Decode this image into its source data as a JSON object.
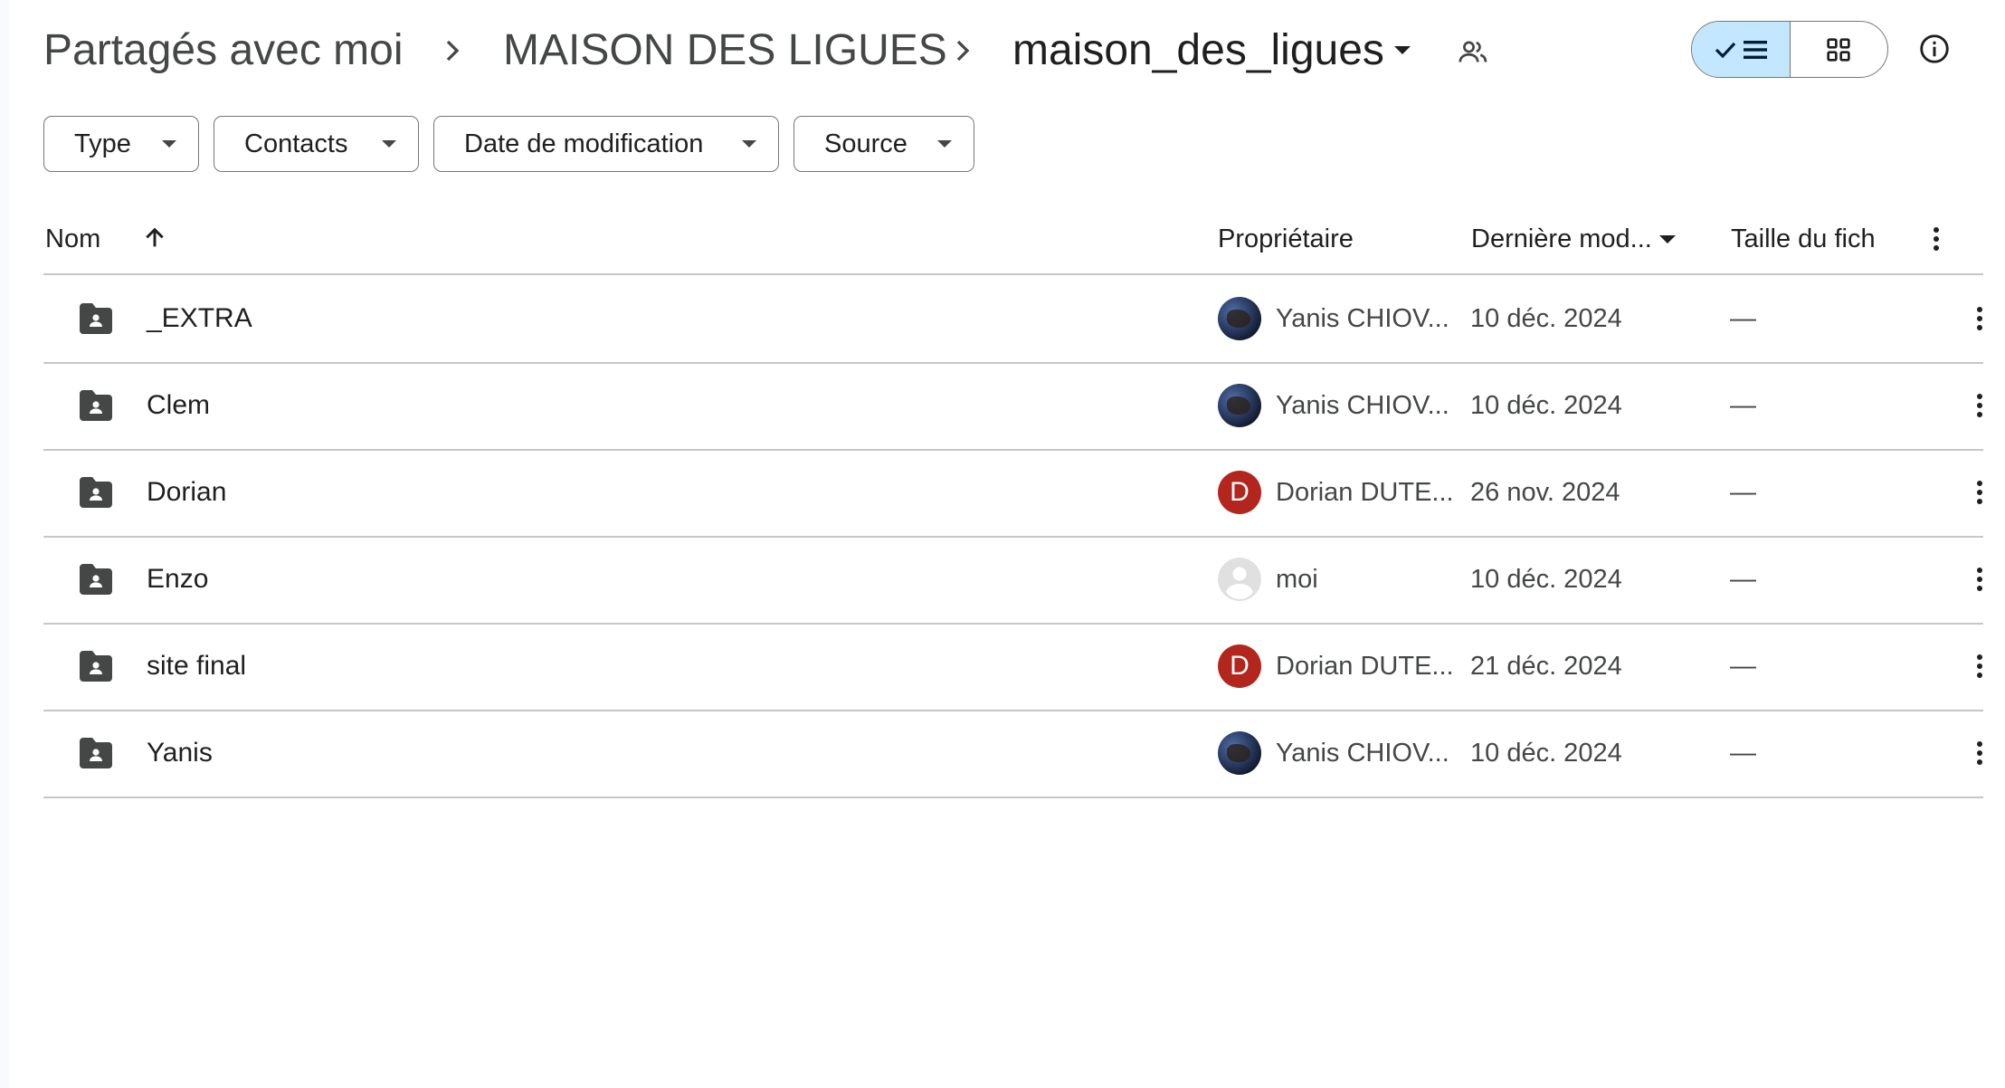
{
  "breadcrumb": {
    "root": "Partagés avec moi",
    "parent": "MAISON DES LIGUES",
    "current": "maison_des_ligues"
  },
  "filters": [
    "Type",
    "Contacts",
    "Date de modification",
    "Source"
  ],
  "columns": {
    "name": "Nom",
    "owner": "Propriétaire",
    "modified": "Dernière mod...",
    "size": "Taille du fich"
  },
  "rows": [
    {
      "name": "_EXTRA",
      "owner": "Yanis CHIOV...",
      "owner_avatar": "photo",
      "modified": "10 déc. 2024",
      "size": "—"
    },
    {
      "name": "Clem",
      "owner": "Yanis CHIOV...",
      "owner_avatar": "photo",
      "modified": "10 déc. 2024",
      "size": "—"
    },
    {
      "name": "Dorian",
      "owner": "Dorian DUTE...",
      "owner_avatar": "D",
      "modified": "26 nov. 2024",
      "size": "—"
    },
    {
      "name": "Enzo",
      "owner": "moi",
      "owner_avatar": "default",
      "modified": "10 déc. 2024",
      "size": "—"
    },
    {
      "name": "site final",
      "owner": "Dorian DUTE...",
      "owner_avatar": "D",
      "modified": "21 déc. 2024",
      "size": "—"
    },
    {
      "name": "Yanis",
      "owner": "Yanis CHIOV...",
      "owner_avatar": "photo",
      "modified": "10 déc. 2024",
      "size": "—"
    }
  ],
  "colors": {
    "accent_toggle": "#c2e7ff",
    "avatar_letter_bg": "#b3261e",
    "divider": "#c7c7c7"
  },
  "icons": {
    "breadcrumb_separator": "chevron-right-icon",
    "current_menu": "caret-down-icon",
    "shared": "people-icon",
    "list_view": "check-list-icon",
    "grid_view": "grid-icon",
    "info": "info-icon",
    "sort": "arrow-up-icon",
    "folder": "shared-folder-icon",
    "more": "more-vert-icon"
  }
}
